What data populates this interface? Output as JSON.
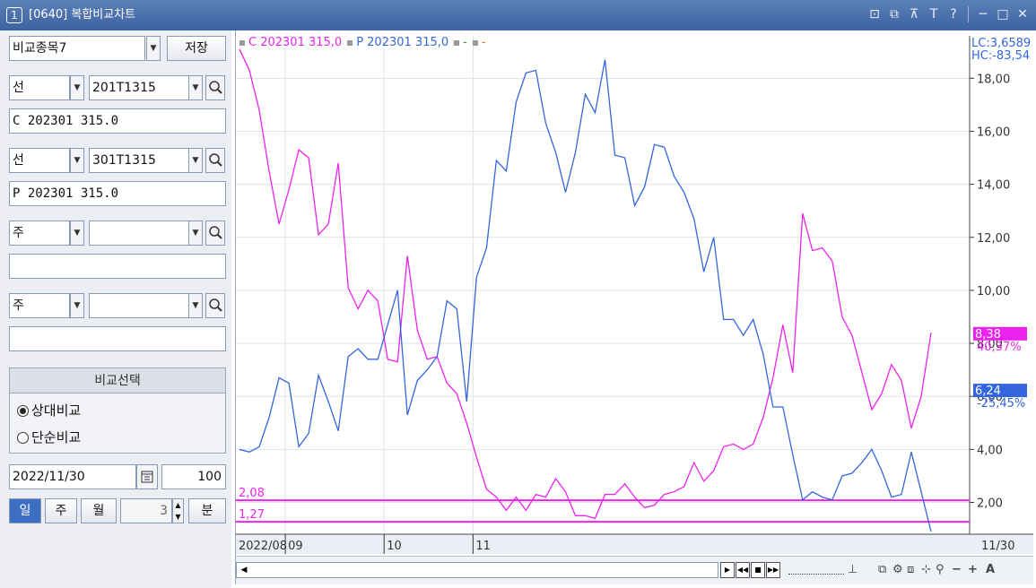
{
  "window": {
    "title_num": "1",
    "title": "[0640] 복합비교차트"
  },
  "title_buttons": [
    "restore-icon",
    "window-icon",
    "pin-icon",
    "font-icon",
    "help-icon",
    "minimize-icon",
    "maximize-icon",
    "close-icon"
  ],
  "title_glyphs": [
    "⊡",
    "⧉",
    "⊼",
    "T",
    "?",
    "─",
    "□",
    "✕"
  ],
  "left": {
    "group_name": "비교종목7",
    "save_label": "저장",
    "rows": [
      {
        "type": "선",
        "code": "201T1315",
        "name": "C 202301 315.0"
      },
      {
        "type": "선",
        "code": "301T1315",
        "name": "P 202301 315.0"
      },
      {
        "type": "주",
        "code": "",
        "name": ""
      },
      {
        "type": "주",
        "code": "",
        "name": ""
      }
    ],
    "compare_title": "비교선택",
    "compare_options": [
      "상대비교",
      "단순비교"
    ],
    "compare_selected": 0,
    "date": "2022/11/30",
    "count": "100",
    "period_buttons": [
      "일",
      "주",
      "월"
    ],
    "period_selected": 0,
    "minute_value": "3",
    "minute_label": "분"
  },
  "legend": {
    "c_label": "C 202301 315,0",
    "p_label": "P 202301 315,0",
    "extra1": "-",
    "extra2": "-"
  },
  "chart_data": {
    "type": "line",
    "y_ticks": [
      "18,00",
      "16,00",
      "14,00",
      "12,00",
      "10,00",
      "8,00",
      "6,00",
      "4,00",
      "2,00"
    ],
    "y_range": [
      0.8,
      19.6
    ],
    "x_labels": [
      "2022/08",
      "09",
      "10",
      "11",
      "11/30"
    ],
    "x_label_index": [
      0,
      5,
      15,
      24,
      36
    ],
    "n_points": 35,
    "series": [
      {
        "name": "C 202301 315,0",
        "color": "#ee22ee",
        "values": [
          19.1,
          18.3,
          16.8,
          14.5,
          12.5,
          13.8,
          15.3,
          15.0,
          12.1,
          12.5,
          14.8,
          10.1,
          9.3,
          10.0,
          9.6,
          7.4,
          7.3,
          11.3,
          8.5,
          7.4,
          7.5,
          6.5,
          6.1,
          5.0,
          3.7,
          2.5,
          2.2,
          1.7,
          2.2,
          1.7,
          2.3,
          2.2,
          2.9,
          2.4,
          1.5,
          1.5,
          1.4,
          2.3,
          2.3,
          2.7,
          2.2,
          1.8,
          1.9,
          2.3,
          2.4,
          2.6,
          3.5,
          2.8,
          3.2,
          4.1,
          4.2,
          4.0,
          4.2,
          5.2,
          6.7,
          8.7,
          6.9,
          12.9,
          11.5,
          11.6,
          11.1,
          9.0,
          8.3,
          6.9,
          5.5,
          6.1,
          7.2,
          6.6,
          4.8,
          6.0,
          8.4
        ]
      },
      {
        "name": "P 202301 315,0",
        "color": "#3366dd",
        "values": [
          4.0,
          3.9,
          4.1,
          5.2,
          6.7,
          6.5,
          4.1,
          4.6,
          6.8,
          5.8,
          4.7,
          7.5,
          7.8,
          7.4,
          7.4,
          8.7,
          10.0,
          5.3,
          6.6,
          7.0,
          7.5,
          9.6,
          9.3,
          5.8,
          10.5,
          11.6,
          14.9,
          14.5,
          17.1,
          18.2,
          18.3,
          16.3,
          15.2,
          13.7,
          15.2,
          17.4,
          16.7,
          18.7,
          15.1,
          15.0,
          13.2,
          13.9,
          15.5,
          15.4,
          14.3,
          13.7,
          12.7,
          10.7,
          12.0,
          8.9,
          8.9,
          8.3,
          8.9,
          7.6,
          5.6,
          5.6,
          3.8,
          2.1,
          2.4,
          2.2,
          2.1,
          3.0,
          3.1,
          3.5,
          4.0,
          3.2,
          2.2,
          2.3,
          3.9,
          2.4,
          0.9
        ]
      }
    ],
    "hlines": [
      {
        "label": "2,08",
        "value": 2.08,
        "color": "#ee22ee"
      },
      {
        "label": "1,27",
        "value": 1.27,
        "color": "#ee22ee"
      }
    ],
    "right_top": [
      "LC:3,6589",
      "HC:-83,54"
    ],
    "c_last": {
      "value": "8,38",
      "pct": "40,37%"
    },
    "p_last": {
      "value": "6,24",
      "pct": "-25,45%"
    },
    "grid": true
  }
}
